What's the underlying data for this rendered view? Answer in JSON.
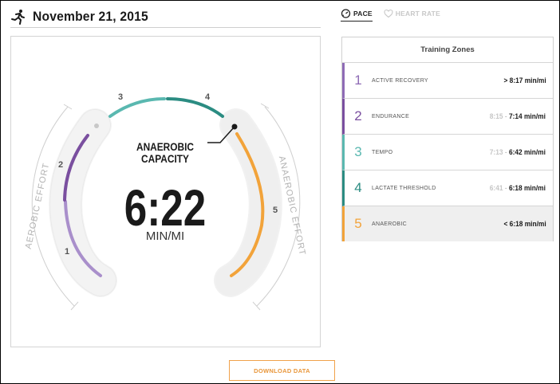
{
  "header": {
    "date": "November 21, 2015",
    "icon": "runner-icon"
  },
  "tabs": [
    {
      "label": "PACE",
      "icon": "stopwatch-icon",
      "active": true
    },
    {
      "label": "HEART RATE",
      "icon": "heart-icon",
      "active": false
    }
  ],
  "gauge": {
    "zone_label_line1": "ANAEROBIC",
    "zone_label_line2": "CAPACITY",
    "pace_value": "6:22",
    "pace_unit": "MIN/MI",
    "left_side_label": "AEROBIC EFFORT",
    "right_side_label": "ANAEROBIC EFFORT",
    "segment_labels": [
      "1",
      "2",
      "3",
      "4",
      "5"
    ]
  },
  "training_zones": {
    "title": "Training Zones",
    "rows": [
      {
        "num": "1",
        "name": "ACTIVE RECOVERY",
        "from": "",
        "prefix": ">",
        "to": "8:17 min/mi",
        "color": "#8e6bb5",
        "selected": false
      },
      {
        "num": "2",
        "name": "ENDURANCE",
        "from": "8:15",
        "prefix": "-",
        "to": "7:14 min/mi",
        "color": "#7a4f9f",
        "selected": false
      },
      {
        "num": "3",
        "name": "TEMPO",
        "from": "7:13",
        "prefix": "-",
        "to": "6:42 min/mi",
        "color": "#5ab8b0",
        "selected": false
      },
      {
        "num": "4",
        "name": "LACTATE THRESHOLD",
        "from": "6:41",
        "prefix": "-",
        "to": "6:18 min/mi",
        "color": "#2b8c82",
        "selected": false
      },
      {
        "num": "5",
        "name": "ANAEROBIC",
        "from": "",
        "prefix": "<",
        "to": "6:18 min/mi",
        "color": "#f2a33a",
        "selected": true
      }
    ]
  },
  "colors": {
    "zone1": "#a98fcb",
    "zone2": "#7a4f9f",
    "zone3": "#5ab8b0",
    "zone4": "#2b8c82",
    "zone5": "#f2a33a",
    "accent": "#e8963a"
  },
  "actions": {
    "download_label": "DOWNLOAD DATA"
  }
}
